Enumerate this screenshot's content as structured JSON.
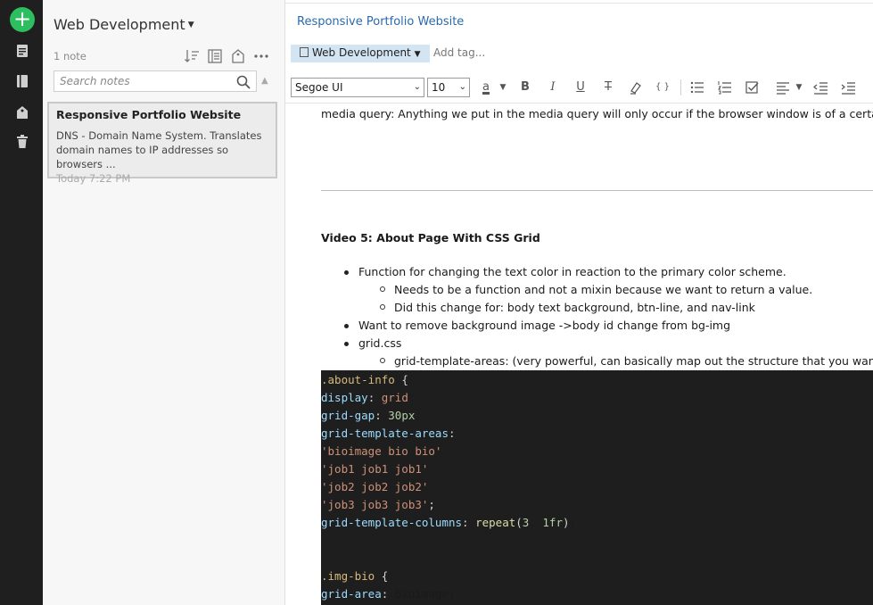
{
  "app": {
    "new_button": "+"
  },
  "notelist": {
    "notebook_title": "Web Development",
    "note_count": "1 note",
    "search_placeholder": "Search notes",
    "card": {
      "title": "Responsive Portfolio Website",
      "snippet": "DNS - Domain Name System. Translates domain names to IP addresses so browsers ...",
      "date": "Today 7:22 PM"
    }
  },
  "editor": {
    "note_title": "Responsive Portfolio Website",
    "notebook_chip": "Web Development",
    "add_tag": "Add tag...",
    "toolbar": {
      "font": "Segoe UI",
      "size": "10",
      "font_color_label": "a",
      "bold": "B",
      "italic": "I",
      "underline": "U",
      "strike": "T",
      "code": "{ }"
    },
    "content": {
      "para": "media query: Anything we put in the media query will only occur if the browser window is of a certain size.",
      "heading": "Video 5: About Page With CSS Grid",
      "bullets": [
        "Function for changing the text color in reaction to the primary color scheme.",
        "Needs to be a function and not a mixin because we want to return a value.",
        "Did this change for: body text background, btn-line, and nav-link",
        "Want to remove background image ->body id change from bg-img",
        "grid.css",
        "grid-template-areas: (very powerful, can basically map out the structure that you want."
      ],
      "code_lines": [
        ".about-info {",
        "display: grid;",
        "grid-gap: 30px;",
        "grid-template-areas:",
        "'bioimage bio bio'",
        "'job1 job1 job1'",
        "'job2 job2 job2'",
        "'job3 job3 job3';",
        "grid-template-columns: repeat(3, 1fr);",
        "",
        "",
        ".img-bio {",
        "grid-area: bioimage;"
      ]
    }
  },
  "colors": {
    "accent": "#2dbe60",
    "rail": "#1f1f1f",
    "title_link": "#2a6aad",
    "chip": "#d3e5f3",
    "code_bg": "#1e1e1e"
  }
}
